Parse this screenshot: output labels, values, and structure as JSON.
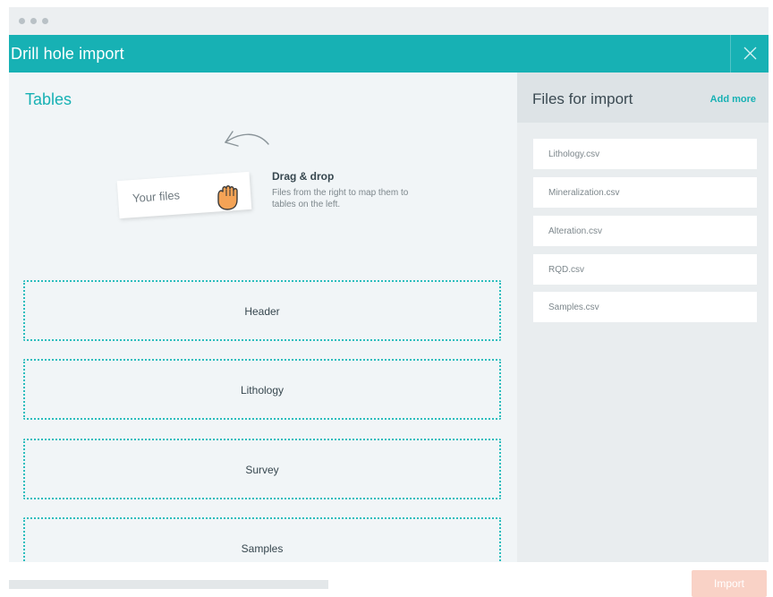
{
  "window": {
    "title": "Drill hole import",
    "close_icon": "close-icon",
    "accent": "#17b1b4"
  },
  "tables_panel": {
    "heading": "Tables",
    "illustration": {
      "card_label": "Your files",
      "hand_icon": "hand-grab-icon",
      "arrow_icon": "curved-arrow-icon"
    },
    "hint": {
      "title": "Drag & drop",
      "description": "Files from the right to map them to tables on the left."
    },
    "drop_zones": [
      {
        "label": "Header"
      },
      {
        "label": "Lithology"
      },
      {
        "label": "Survey"
      },
      {
        "label": "Samples"
      }
    ]
  },
  "files_panel": {
    "title": "Files for import",
    "add_more_label": "Add more",
    "files": [
      {
        "name": "Lithology.csv"
      },
      {
        "name": "Mineralization.csv"
      },
      {
        "name": "Alteration.csv"
      },
      {
        "name": "RQD.csv"
      },
      {
        "name": "Samples.csv"
      }
    ]
  },
  "footer": {
    "import_label": "Import",
    "import_color": "#f9d2c6"
  }
}
